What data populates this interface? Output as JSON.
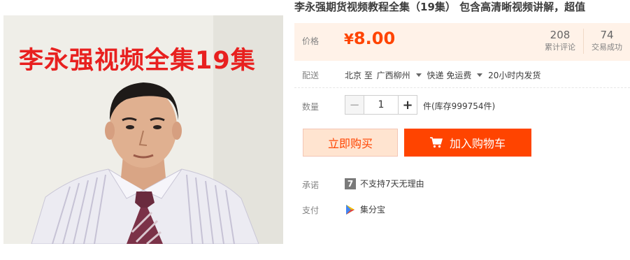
{
  "product": {
    "image_banner_text": "李永强视频全集19集",
    "title": "李永强期货视频教程全集（19集） 包含高清晰视频讲解，超值"
  },
  "price": {
    "label": "价格",
    "currency": "¥",
    "amount": "8.00",
    "reviews_count": "208",
    "reviews_label": "累计评论",
    "deals_count": "74",
    "deals_label": "交易成功"
  },
  "shipping": {
    "label": "配送",
    "from": "北京 至",
    "to": "广西柳州",
    "method": "快递 免运费",
    "dispatch": "20小时内发货"
  },
  "quantity": {
    "label": "数量",
    "minus": "−",
    "value": "1",
    "plus": "+",
    "stock": "件(库存999754件)"
  },
  "actions": {
    "buy_now": "立即购买",
    "add_to_cart": "加入购物车"
  },
  "promise": {
    "label": "承诺",
    "badge": "7",
    "text": "不支持7天无理由"
  },
  "payment": {
    "label": "支付",
    "method": "集分宝"
  },
  "colors": {
    "accent": "#ff4400",
    "price_bg": "#fff2e8"
  }
}
